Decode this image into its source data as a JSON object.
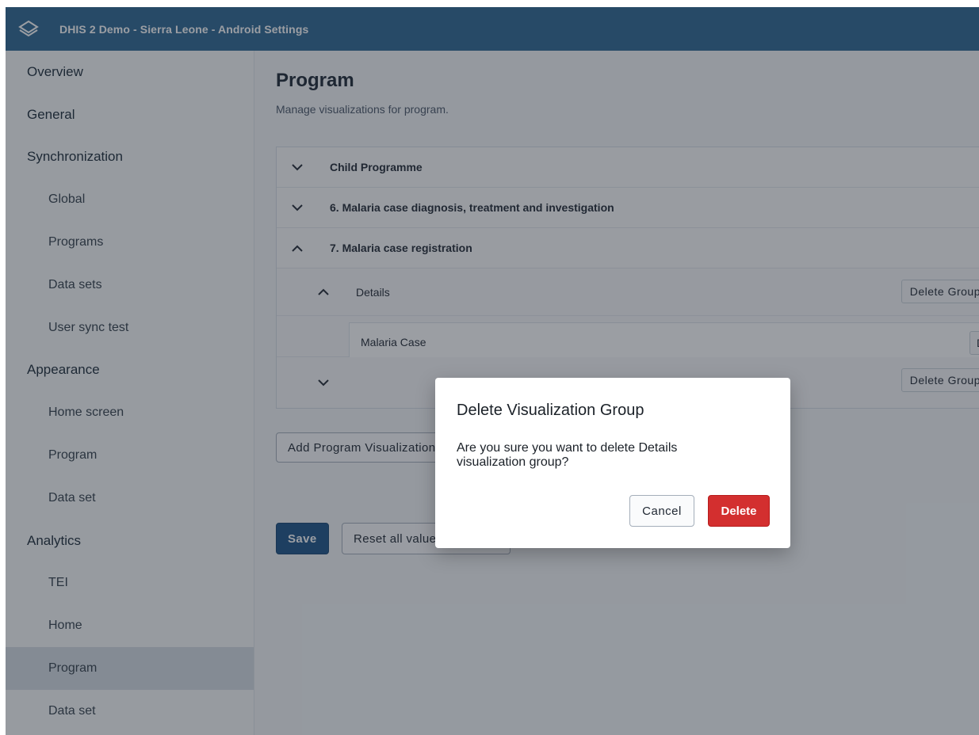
{
  "app": {
    "title": "DHIS 2 Demo - Sierra Leone - Android Settings",
    "accent_color": "#2c6693"
  },
  "sidebar": {
    "items": [
      {
        "label": "Overview",
        "level": "top"
      },
      {
        "label": "General",
        "level": "top"
      },
      {
        "label": "Synchronization",
        "level": "top"
      },
      {
        "label": "Global",
        "level": "sub"
      },
      {
        "label": "Programs",
        "level": "sub"
      },
      {
        "label": "Data sets",
        "level": "sub"
      },
      {
        "label": "User sync test",
        "level": "sub"
      },
      {
        "label": "Appearance",
        "level": "top"
      },
      {
        "label": "Home screen",
        "level": "sub"
      },
      {
        "label": "Program",
        "level": "sub"
      },
      {
        "label": "Data set",
        "level": "sub"
      },
      {
        "label": "Analytics",
        "level": "top"
      },
      {
        "label": "TEI",
        "level": "sub"
      },
      {
        "label": "Home",
        "level": "sub"
      },
      {
        "label": "Program",
        "level": "sub",
        "active": true
      },
      {
        "label": "Data set",
        "level": "sub"
      }
    ]
  },
  "main": {
    "title": "Program",
    "subtitle": "Manage visualizations for program.",
    "programs": [
      {
        "label": "Child Programme",
        "expanded": false
      },
      {
        "label": "6. Malaria case diagnosis, treatment and investigation",
        "expanded": false
      },
      {
        "label": "7. Malaria case registration",
        "expanded": true
      }
    ],
    "groups": [
      {
        "label": "Details",
        "expanded": true,
        "delete_label": "Delete Group"
      },
      {
        "label": "",
        "expanded": false,
        "delete_label": "Delete Group"
      }
    ],
    "visualization": {
      "label": "Malaria Case",
      "delete_label": "Delete"
    },
    "add_button": "Add Program Visualization",
    "save_button": "Save",
    "reset_button": "Reset all values to default"
  },
  "modal": {
    "title": "Delete Visualization Group",
    "body": "Are you sure you want to delete Details visualization group?",
    "cancel": "Cancel",
    "delete": "Delete",
    "delete_color": "#d32f2f"
  }
}
